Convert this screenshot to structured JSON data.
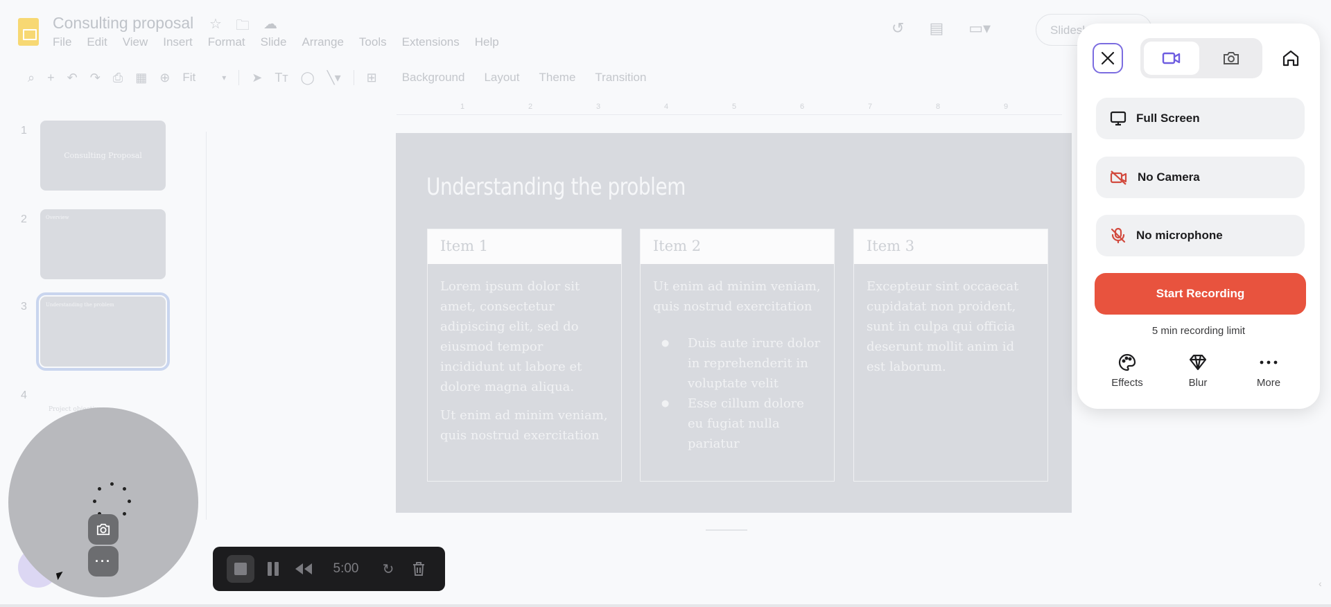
{
  "document": {
    "title": "Consulting proposal",
    "menu": [
      "File",
      "Edit",
      "View",
      "Insert",
      "Format",
      "Slide",
      "Arrange",
      "Tools",
      "Extensions",
      "Help"
    ],
    "slideshow_label": "Slidesh"
  },
  "toolbar": {
    "zoom": "Fit",
    "buttons": [
      "Background",
      "Layout",
      "Theme",
      "Transition"
    ]
  },
  "ruler": [
    "1",
    "2",
    "3",
    "4",
    "5",
    "6",
    "7",
    "8",
    "9"
  ],
  "thumbnails": [
    {
      "number": "1",
      "title": "Consulting Proposal"
    },
    {
      "number": "2",
      "title": "Overview"
    },
    {
      "number": "3",
      "title": "Understanding the problem"
    },
    {
      "number": "4",
      "title": "Project objective"
    }
  ],
  "slide": {
    "heading": "Understanding the problem",
    "items": [
      {
        "title": "Item 1",
        "paragraphs": [
          "Lorem ipsum dolor sit amet, consectetur adipiscing elit, sed do eiusmod tempor incididunt ut labore et dolore magna aliqua.",
          "Ut enim ad minim veniam, quis nostrud exercitation"
        ]
      },
      {
        "title": "Item 2",
        "paragraphs": [
          "Ut enim ad minim veniam, quis nostrud exercitation"
        ],
        "bullets": [
          "Duis aute irure dolor in reprehenderit in voluptate velit",
          "Esse cillum dolore eu fugiat nulla pariatur"
        ]
      },
      {
        "title": "Item 3",
        "paragraphs": [
          "Excepteur sint occaecat cupidatat non proident, sunt in culpa qui officia deserunt mollit anim id est laborum."
        ]
      }
    ]
  },
  "recording_bar": {
    "time": "5:00"
  },
  "recorder": {
    "options": {
      "screen": "Full Screen",
      "camera": "No Camera",
      "microphone": "No microphone"
    },
    "start_label": "Start Recording",
    "limit_text": "5 min recording limit",
    "tools": [
      "Effects",
      "Blur",
      "More"
    ],
    "colors": {
      "accent": "#7b6ce0",
      "start": "#e8533e",
      "disabled_icon": "#d24a3e"
    }
  }
}
